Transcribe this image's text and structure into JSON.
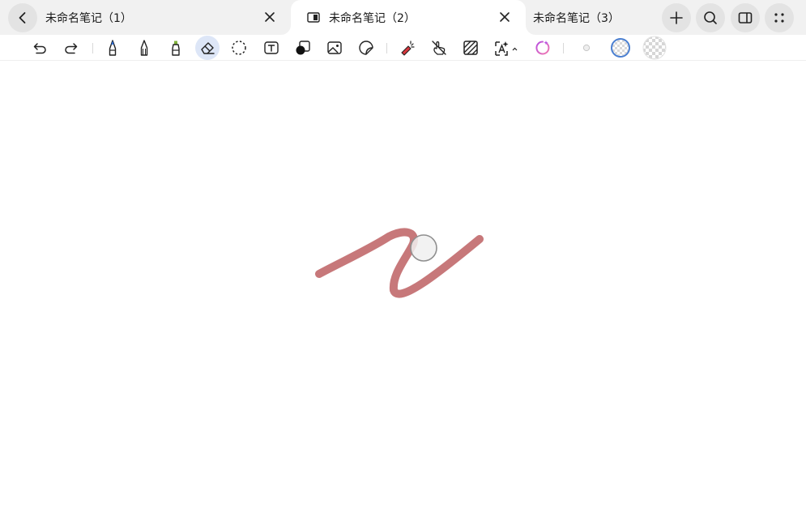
{
  "tabs": [
    {
      "label": "未命名笔记（1）",
      "active": false
    },
    {
      "label": "未命名笔记（2）",
      "active": true
    },
    {
      "label": "未命名笔记（3）",
      "active": false
    }
  ],
  "header_buttons": [
    "back-icon",
    "plus-icon",
    "search-icon",
    "sidebar-icon",
    "more-grid-icon"
  ],
  "toolbar": {
    "tools": [
      "undo-icon",
      "redo-icon",
      "pen-icon",
      "pencil-icon",
      "marker-icon",
      "eraser-icon",
      "lasso-icon",
      "text-box-icon",
      "shape-icon",
      "image-icon",
      "sticker-icon",
      "laser-pointer-icon",
      "hand-draw-off-icon",
      "hatch-fill-icon",
      "ai-text-icon",
      "ai-spinner-icon",
      "small-dot-size-icon",
      "current-color-swatch-icon",
      "transparent-color-swatch-icon"
    ],
    "selected_tool": "eraser-icon"
  },
  "colors": {
    "stroke": "#c7787a",
    "tab_bar_bg": "#f1f1f1",
    "selected_tool_bg": "#dde6f7",
    "swatch_ring": "#4a7fd1"
  }
}
